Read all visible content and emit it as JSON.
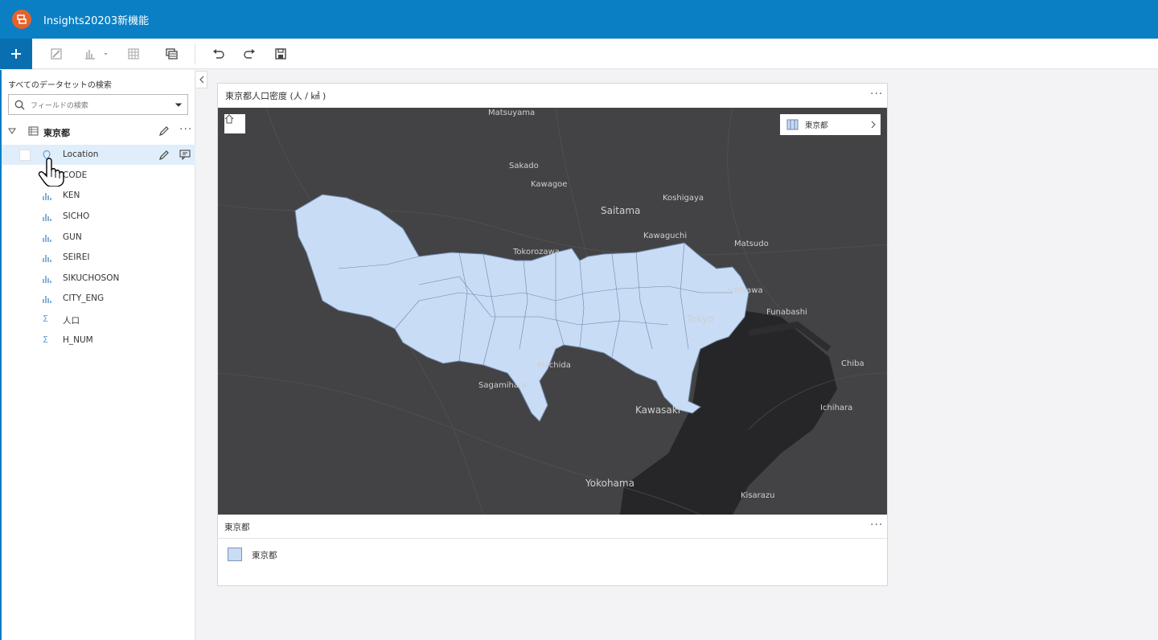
{
  "app": {
    "title": "Insights20203新機能",
    "colors": {
      "header": "#0a7fc4",
      "accent": "#0a6fb0",
      "logo": "#e8612c"
    }
  },
  "toolbar": {
    "items": [
      "add-icon",
      "card-icon",
      "chart-icon",
      "table-icon",
      "layers-icon",
      "undo-icon",
      "redo-icon",
      "save-icon"
    ]
  },
  "data_panel": {
    "search_title": "すべてのデータセットの検索",
    "search_placeholder": "フィールドの検索",
    "dataset": "東京都",
    "fields": [
      {
        "label": "Location",
        "type": "location"
      },
      {
        "label": "CODE",
        "type": "string"
      },
      {
        "label": "KEN",
        "type": "string"
      },
      {
        "label": "SICHO",
        "type": "string"
      },
      {
        "label": "GUN",
        "type": "string"
      },
      {
        "label": "SEIREI",
        "type": "string"
      },
      {
        "label": "SIKUCHOSON",
        "type": "string"
      },
      {
        "label": "CITY_ENG",
        "type": "string"
      },
      {
        "label": "人口",
        "type": "number"
      },
      {
        "label": "H_NUM",
        "type": "number"
      }
    ]
  },
  "card": {
    "title": "東京都人口密度 (人 / ㎢ )",
    "map": {
      "layer_chip_label": "東京都",
      "places": [
        {
          "name": "Matsuyama"
        },
        {
          "name": "Sakado"
        },
        {
          "name": "Kawagoe"
        },
        {
          "name": "Koshigaya"
        },
        {
          "name": "Saitama"
        },
        {
          "name": "Kawaguchi"
        },
        {
          "name": "Matsudo"
        },
        {
          "name": "Tokorozawa"
        },
        {
          "name": "Ichikawa"
        },
        {
          "name": "Funabashi"
        },
        {
          "name": "Tokyo"
        },
        {
          "name": "Chiba"
        },
        {
          "name": "Machida"
        },
        {
          "name": "Sagamihara"
        },
        {
          "name": "Kawasaki"
        },
        {
          "name": "Ichihara"
        },
        {
          "name": "Yokohama"
        },
        {
          "name": "Kisarazu"
        }
      ]
    },
    "legend": {
      "title": "東京都",
      "item": "東京都",
      "color": "#c8dcf6"
    }
  }
}
